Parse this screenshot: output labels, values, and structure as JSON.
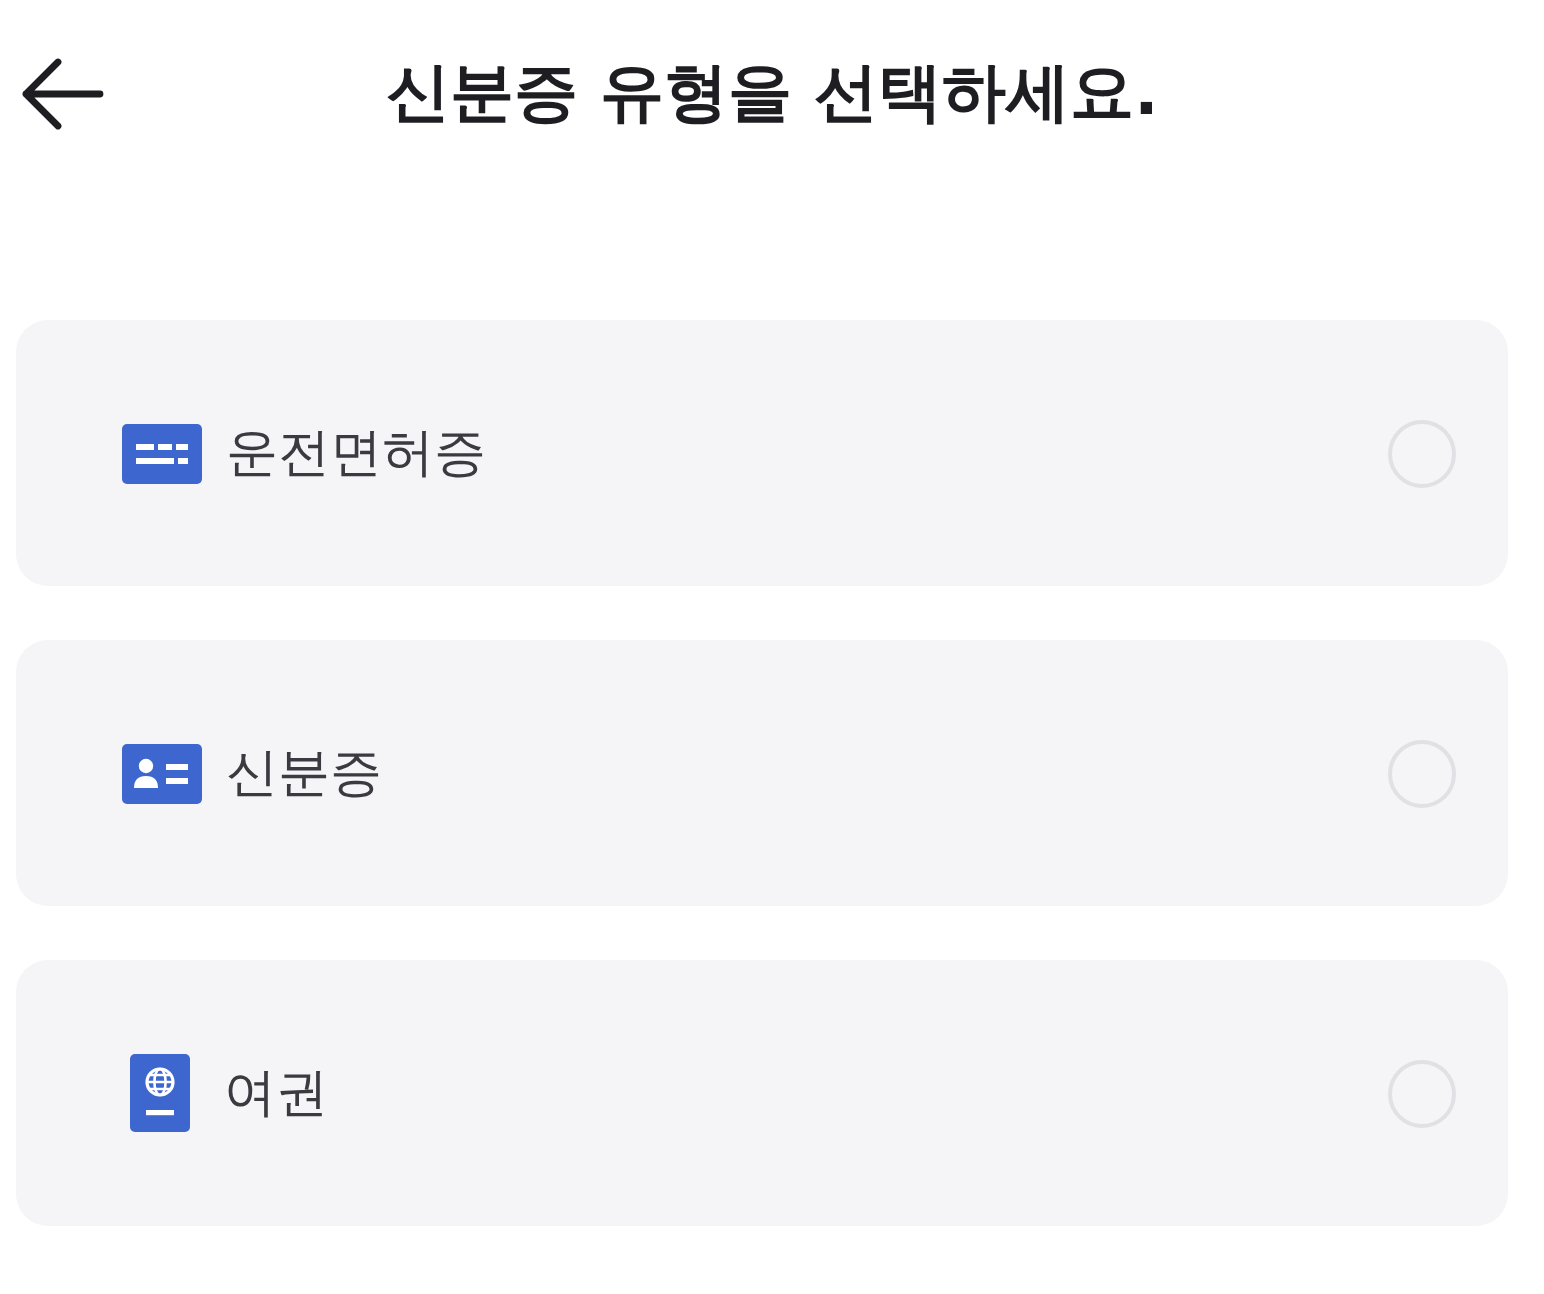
{
  "header": {
    "title": "신분증 유형을 선택하세요."
  },
  "options": [
    {
      "kind": "license",
      "label": "운전면허증",
      "selected": false
    },
    {
      "kind": "id_card",
      "label": "신분증",
      "selected": false
    },
    {
      "kind": "passport",
      "label": "여권",
      "selected": false
    }
  ]
}
